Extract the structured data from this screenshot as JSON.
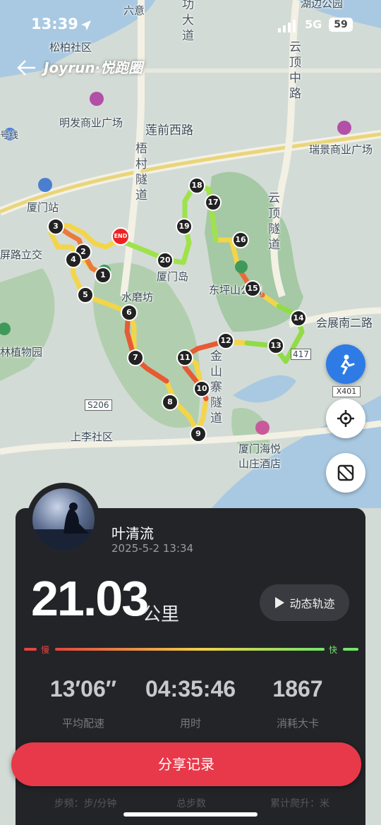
{
  "status": {
    "time": "13:39",
    "network": "5G",
    "battery": "59"
  },
  "app": {
    "brand": "Joyrun·悦跑圈"
  },
  "map": {
    "place_labels": [
      {
        "text": "六意",
        "key": "liuyi"
      },
      {
        "text": "湖边公园",
        "key": "hubian"
      },
      {
        "text": "松柏社区",
        "key": "songbai"
      },
      {
        "text": "明发商业广场",
        "key": "mingfa"
      },
      {
        "text": "莲前西路",
        "key": "lianqian"
      },
      {
        "text": "瑞景商业广场",
        "key": "ruijing"
      },
      {
        "text": "厦门站",
        "key": "xiamenzhan"
      },
      {
        "text": "屏路立交",
        "key": "pinglu"
      },
      {
        "text": "厦门岛",
        "key": "xiamendao"
      },
      {
        "text": "水磨坊",
        "key": "shuimofang"
      },
      {
        "text": "东坪山公园",
        "key": "dongping"
      },
      {
        "text": "会展南二路",
        "key": "huizhan"
      },
      {
        "text": "林植物园",
        "key": "zhiwuyuan"
      },
      {
        "text": "上李社区",
        "key": "shangli"
      },
      {
        "text": "厦门海悦山庄酒店",
        "key": "haiyue"
      },
      {
        "text": "S206",
        "key": "s206"
      },
      {
        "text": "417",
        "key": "r417"
      },
      {
        "text": "号线",
        "key": "haoxian"
      }
    ],
    "vertical_labels": [
      {
        "text": "梧村隧道",
        "key": "wucun"
      },
      {
        "text": "云顶隧道",
        "key": "yunding"
      },
      {
        "text": "云顶中路",
        "key": "yundingzhong"
      },
      {
        "text": "功大道",
        "key": "gongdadao"
      },
      {
        "text": "金山寨隧道",
        "key": "jinshan"
      }
    ],
    "route_markers": [
      "1",
      "2",
      "3",
      "4",
      "5",
      "6",
      "7",
      "8",
      "9",
      "10",
      "11",
      "12",
      "13",
      "14",
      "15",
      "16",
      "17",
      "18",
      "19",
      "20"
    ],
    "end_label": "END",
    "road_badge": "X401"
  },
  "summary": {
    "user_name": "叶清流",
    "date": "2025-5-2 13:34",
    "distance": "21.03",
    "distance_unit": "公里",
    "replay_label": "动态轨迹",
    "slow_label": "慢",
    "fast_label": "快",
    "stats": [
      {
        "value": "13′06′′",
        "label": "平均配速"
      },
      {
        "value": "04:35:46",
        "label": "用时"
      },
      {
        "value": "1867",
        "label": "消耗大卡"
      }
    ],
    "share_label": "分享记录",
    "more_stats": [
      "步频：步/分钟",
      "总步数",
      "累计爬升：米"
    ]
  },
  "colors": {
    "accent": "#e8394a",
    "card": "#232428",
    "slow": "#e3453f",
    "fast": "#74e36a"
  }
}
